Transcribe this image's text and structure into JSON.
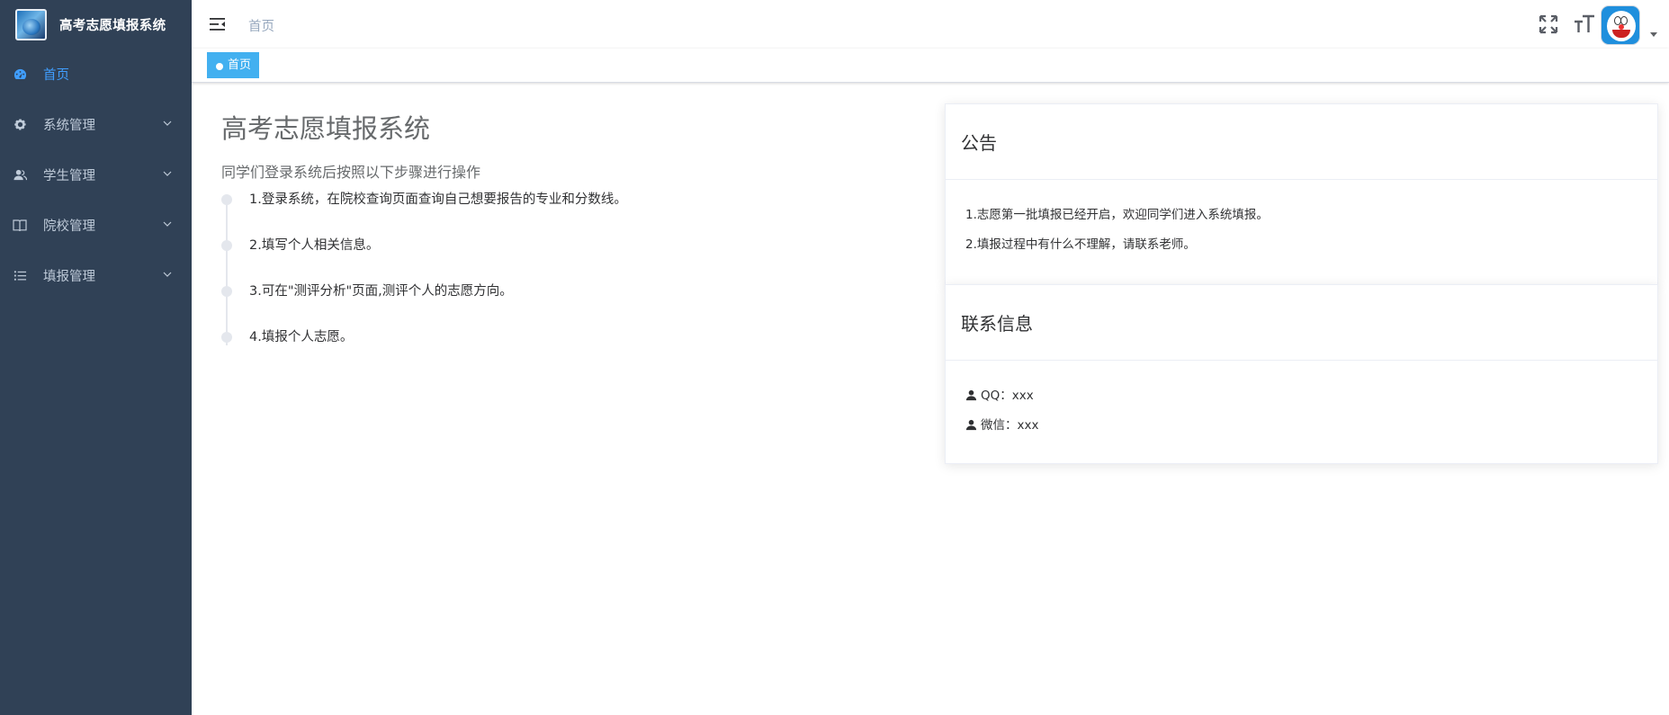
{
  "app": {
    "title": "高考志愿填报系统"
  },
  "sidebar": {
    "items": [
      {
        "label": "首页",
        "icon": "dashboard-icon",
        "active": true,
        "has_children": false
      },
      {
        "label": "系统管理",
        "icon": "gear-icon",
        "active": false,
        "has_children": true
      },
      {
        "label": "学生管理",
        "icon": "user-icon",
        "active": false,
        "has_children": true
      },
      {
        "label": "院校管理",
        "icon": "book-icon",
        "active": false,
        "has_children": true
      },
      {
        "label": "填报管理",
        "icon": "list-icon",
        "active": false,
        "has_children": true
      }
    ]
  },
  "navbar": {
    "breadcrumb": "首页",
    "icons": [
      "hamburger-icon",
      "fullscreen-icon",
      "font-size-icon",
      "avatar",
      "caret-down-icon"
    ]
  },
  "tags_view": {
    "tags": [
      {
        "label": "首页",
        "active": true
      }
    ]
  },
  "main": {
    "title": "高考志愿填报系统",
    "subtitle": "同学们登录系统后按照以下步骤进行操作",
    "steps": [
      "1.登录系统，在院校查询页面查询自己想要报告的专业和分数线。",
      "2.填写个人相关信息。",
      "3.可在\"测评分析\"页面,测评个人的志愿方向。",
      "4.填报个人志愿。"
    ]
  },
  "notice": {
    "title": "公告",
    "lines": [
      "1.志愿第一批填报已经开启，欢迎同学们进入系统填报。",
      "2.填报过程中有什么不理解，请联系老师。"
    ]
  },
  "contact": {
    "title": "联系信息",
    "lines": [
      "QQ：xxx",
      "微信：xxx"
    ]
  },
  "colors": {
    "sidebar_bg": "#304156",
    "sidebar_text": "#bfcbd9",
    "accent": "#409eff",
    "tag_bg": "#42b0f0"
  }
}
